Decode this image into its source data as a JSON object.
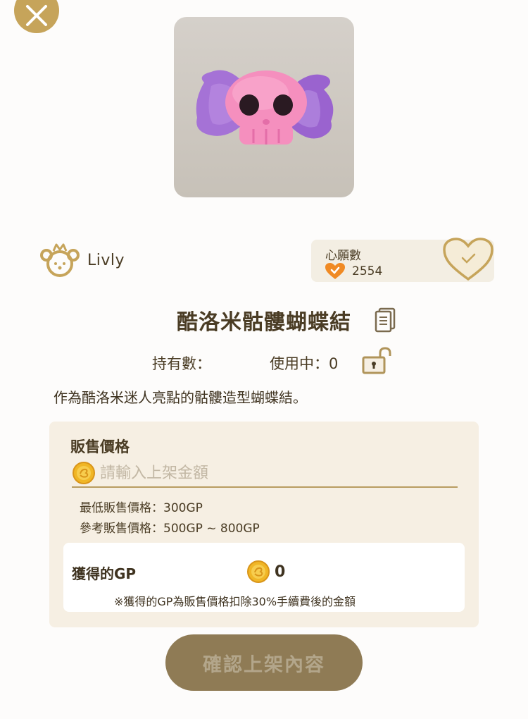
{
  "item": {
    "title": "酷洛米骷髏蝴蝶結",
    "description": "作為酷洛米迷人亮點的骷髏造型蝴蝶結。",
    "image_icon": "skull-bow-icon"
  },
  "brand": {
    "name": "Livly",
    "icon": "livly-logo-icon"
  },
  "wishlist": {
    "label": "心願數",
    "count": "2554",
    "icon": "heart-check-icon"
  },
  "ownership": {
    "owned_label": "持有數：",
    "in_use_label": "使用中：0"
  },
  "sell": {
    "section_title": "販售價格",
    "price_placeholder": "請輸入上架金額",
    "min_price": "最低販售價格：300GP",
    "reference_price": "參考販售價格：500GP ~ 800GP",
    "earned_label": "獲得的GP",
    "earned_value": "0",
    "fee_note": "※獲得的GP為販售價格扣除30%手續費後的金額"
  },
  "confirm_button": {
    "label": "確認上架內容"
  },
  "colors": {
    "accent_gold": "#c6a45a",
    "button_brown": "#8f7b55",
    "panel_bg": "#f6efe3",
    "heart_orange": "#f08a24"
  }
}
